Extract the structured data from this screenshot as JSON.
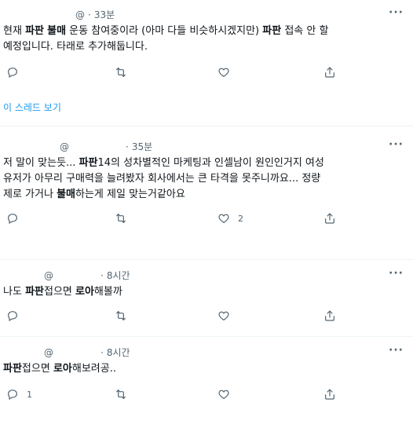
{
  "tweets": [
    {
      "at": "@",
      "time": "33분",
      "body": [
        {
          "t": "현재 ",
          "b": false
        },
        {
          "t": "파판",
          "b": true
        },
        {
          "t": " ",
          "b": false
        },
        {
          "t": "불매",
          "b": true
        },
        {
          "t": " 운동 참여중이라 (아마 다들 비슷하시겠지만) ",
          "b": false
        },
        {
          "t": "파판",
          "b": true
        },
        {
          "t": " 접속 안 할\n예정입니다. 타래로 추가해둡니다.",
          "b": false
        }
      ],
      "counts": {
        "reply": "",
        "retweet": "",
        "like": "",
        "share": ""
      }
    },
    {
      "at": "@",
      "time": "35분",
      "body": [
        {
          "t": "저 말이 맞는듯... ",
          "b": false
        },
        {
          "t": "파판",
          "b": true
        },
        {
          "t": "14의 성차별적인 마케팅과 인셀남이 원인인거지 여성\n유저가 아무리 구매력을 늘려봤자 회사에서는 큰 타격을 못주니까요... 정량\n제로 가거나 ",
          "b": false
        },
        {
          "t": "불매",
          "b": true
        },
        {
          "t": "하는게 제일 맞는거같아요",
          "b": false
        }
      ],
      "counts": {
        "reply": "",
        "retweet": "",
        "like": "2",
        "share": ""
      }
    },
    {
      "at": "@",
      "time": "8시간",
      "body": [
        {
          "t": "나도 ",
          "b": false
        },
        {
          "t": "파판",
          "b": true
        },
        {
          "t": "접으면 ",
          "b": false
        },
        {
          "t": "로아",
          "b": true
        },
        {
          "t": "해볼까",
          "b": false
        }
      ],
      "counts": {
        "reply": "",
        "retweet": "",
        "like": "",
        "share": ""
      }
    },
    {
      "at": "@",
      "time": "8시간",
      "body": [
        {
          "t": "파판",
          "b": true
        },
        {
          "t": "접으면 ",
          "b": false
        },
        {
          "t": "로아",
          "b": true
        },
        {
          "t": "해보려공..",
          "b": false
        }
      ],
      "counts": {
        "reply": "1",
        "retweet": "",
        "like": "",
        "share": ""
      }
    }
  ],
  "thread_link": "이 스레드 보기",
  "more_glyph": "···",
  "colors": {
    "accent": "#1d9bf0",
    "muted": "#536471",
    "text": "#0f1419",
    "divider": "#eff3f4"
  },
  "icons": {
    "reply": "reply-icon",
    "retweet": "retweet-icon",
    "like": "heart-icon",
    "share": "share-icon",
    "more": "more-icon"
  }
}
